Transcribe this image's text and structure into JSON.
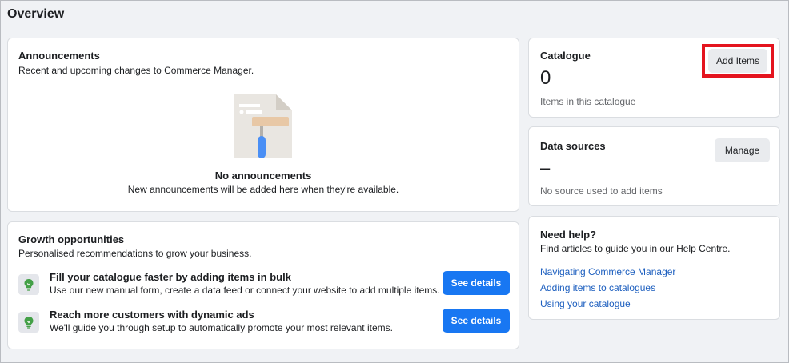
{
  "page": {
    "title": "Overview"
  },
  "announcements": {
    "title": "Announcements",
    "subtitle": "Recent and upcoming changes to Commerce Manager.",
    "empty_title": "No announcements",
    "empty_subtitle": "New announcements will be added here when they're available."
  },
  "growth": {
    "title": "Growth opportunities",
    "subtitle": "Personalised recommendations to grow your business.",
    "items": [
      {
        "title": "Fill your catalogue faster by adding items in bulk",
        "description": "Use our new manual form, create a data feed or connect your website to add multiple items.",
        "button": "See details",
        "icon": "lightbulb-icon"
      },
      {
        "title": "Reach more customers with dynamic ads",
        "description": "We'll guide you through setup to automatically promote your most relevant items.",
        "button": "See details",
        "icon": "lightbulb-icon"
      }
    ]
  },
  "catalogue": {
    "title": "Catalogue",
    "count": "0",
    "caption": "Items in this catalogue",
    "button": "Add Items"
  },
  "data_sources": {
    "title": "Data sources",
    "value": "–",
    "caption": "No source used to add items",
    "button": "Manage"
  },
  "help": {
    "title": "Need help?",
    "subtitle": "Find articles to guide you in our Help Centre.",
    "links": [
      "Navigating Commerce Manager",
      "Adding items to catalogues",
      "Using your catalogue"
    ]
  },
  "colors": {
    "primary": "#1877f2",
    "highlight": "#e4141e",
    "link": "#1d5fbf",
    "background": "#f0f2f5",
    "icon_green": "#43a047"
  }
}
